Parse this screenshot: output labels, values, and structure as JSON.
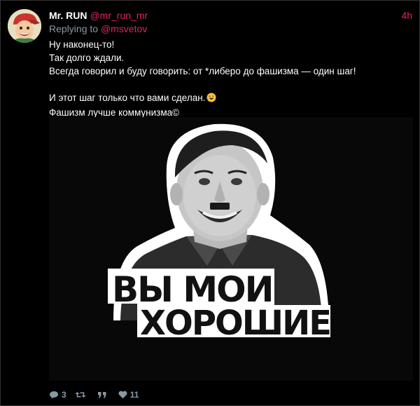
{
  "tweet": {
    "author_name": "Mr. RUN",
    "author_handle": "@mr_run_mr",
    "time": "4h",
    "reply_prefix": "Replying to",
    "reply_to": "@msvetov",
    "lines": [
      "Ну наконец-то!",
      "Так долго ждали.",
      "Всегда говорил и буду говорить: от *либеро до фашизма — один шаг!",
      "И этот шаг только что вами сделан.",
      "Фашизм лучше коммунизма©"
    ],
    "emoji": "laughing-with-tears-icon"
  },
  "media": {
    "sticker_text_line1": "ВЫ МОИ",
    "sticker_text_line2": "ХОРОШИЕ"
  },
  "actions": {
    "reply_count": "3",
    "retweet_count": "",
    "quote_count": "",
    "like_count": "11"
  },
  "colors": {
    "accent": "#e0245e",
    "muted": "#8899a6",
    "background": "#000000"
  }
}
